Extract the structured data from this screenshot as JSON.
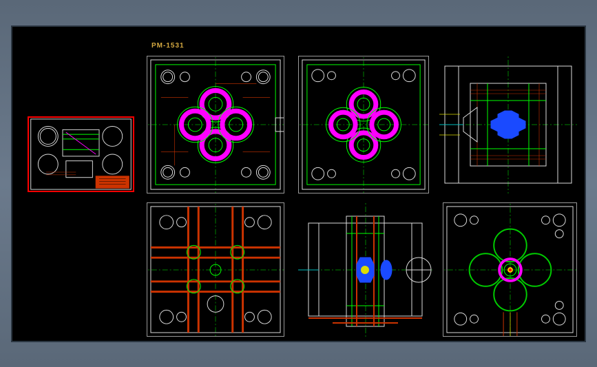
{
  "drawing": {
    "title": "PM-1531",
    "colors": {
      "magenta": "#ff00ff",
      "green": "#00ff00",
      "red": "#cc3300",
      "blue": "#1a4aff",
      "cyan": "#00c0c0",
      "yellow": "#dddd00",
      "white": "#dddddd"
    },
    "views": [
      {
        "id": "title-block",
        "type": "thumbnail"
      },
      {
        "id": "top-front-plate",
        "type": "plan"
      },
      {
        "id": "top-rear-plate",
        "type": "plan"
      },
      {
        "id": "top-section",
        "type": "section"
      },
      {
        "id": "bottom-front-plate",
        "type": "plan"
      },
      {
        "id": "bottom-section",
        "type": "section"
      },
      {
        "id": "bottom-rear-plate",
        "type": "plan"
      }
    ]
  }
}
